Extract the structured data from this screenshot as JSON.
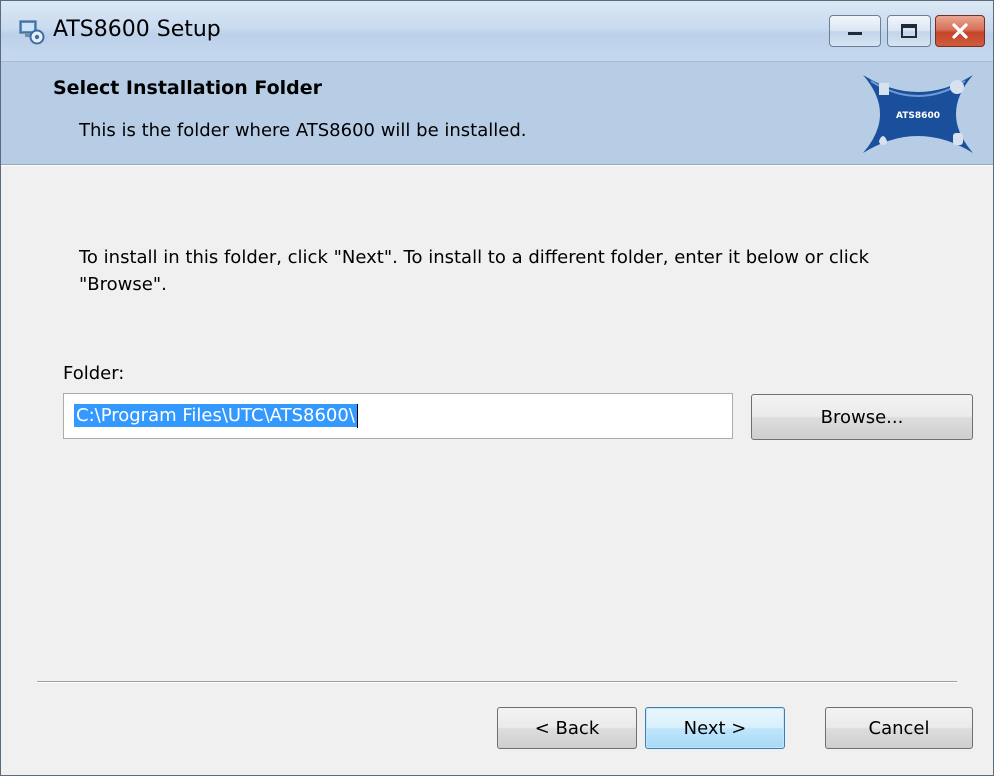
{
  "window": {
    "title": "ATS8600 Setup",
    "controls": {
      "minimize_icon": "minimize-icon",
      "maximize_icon": "maximize-icon",
      "close_icon": "close-icon"
    }
  },
  "header": {
    "title": "Select Installation Folder",
    "subtitle": "This is the folder where ATS8600 will be installed.",
    "logo_text": "ATS8600"
  },
  "main": {
    "instruction": "To install in this folder, click \"Next\". To install to a different folder, enter it below or click \"Browse\".",
    "folder_label": "Folder:",
    "folder_value": "C:\\Program Files\\UTC\\ATS8600\\",
    "browse_label": "Browse..."
  },
  "footer": {
    "back_label": "< Back",
    "next_label": "Next >",
    "cancel_label": "Cancel"
  },
  "colors": {
    "banner": "#b7cde6",
    "selection": "#3399ff",
    "logo_blue": "#1a4f9c",
    "close_red": "#c4452b"
  }
}
